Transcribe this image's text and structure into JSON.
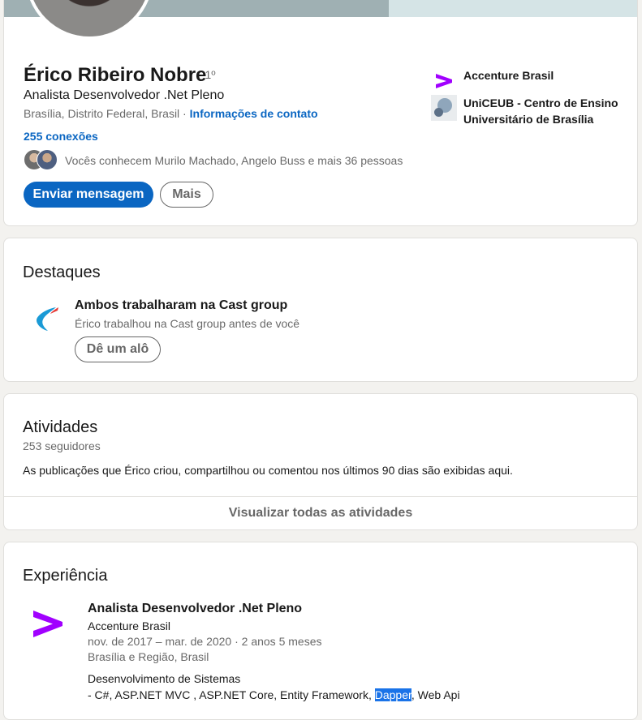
{
  "profile": {
    "name": "Érico Ribeiro Nobre",
    "degree": "· 1º",
    "headline": "Analista Desenvolvedor .Net Pleno",
    "location": "Brasília, Distrito Federal, Brasil",
    "location_sep": " · ",
    "contact_link": "Informações de contato",
    "connections": "255 conexões",
    "mutual": "Vocês conhecem Murilo Machado, Angelo Buss e mais 36 pessoas",
    "message_button": "Enviar mensagem",
    "more_button": "Mais",
    "orgs": [
      {
        "name": "Accenture Brasil",
        "logo": "accenture-logo"
      },
      {
        "name": "UniCEUB - Centro de Ensino Universitário de Brasília",
        "logo": "uniceub-logo"
      }
    ]
  },
  "highlights": {
    "title": "Destaques",
    "item_title": "Ambos trabalharam na Cast group",
    "item_subtitle": "Érico trabalhou na Cast group antes de você",
    "button": "Dê um alô"
  },
  "activities": {
    "title": "Atividades",
    "followers": "253 seguidores",
    "description": "As publicações que Érico criou, compartilhou ou comentou nos últimos 90 dias são exibidas aqui.",
    "footer_link": "Visualizar todas as atividades"
  },
  "experience": {
    "title": "Experiência",
    "job_title": "Analista Desenvolvedor .Net Pleno",
    "company": "Accenture Brasil",
    "dates": "nov. de 2017 – mar. de 2020 · 2 anos 5 meses",
    "location": "Brasília e Região, Brasil",
    "desc_line1": "Desenvolvimento de Sistemas",
    "desc_line2_a": "- C#, ASP.NET MVC , ASP.NET Core, Entity Framework, ",
    "desc_line2_selected": "Dapper",
    "desc_line2_b": ", Web Api"
  },
  "colors": {
    "link": "#0a66c2",
    "accenture": "#a100ff",
    "selection": "#1a73e8"
  }
}
